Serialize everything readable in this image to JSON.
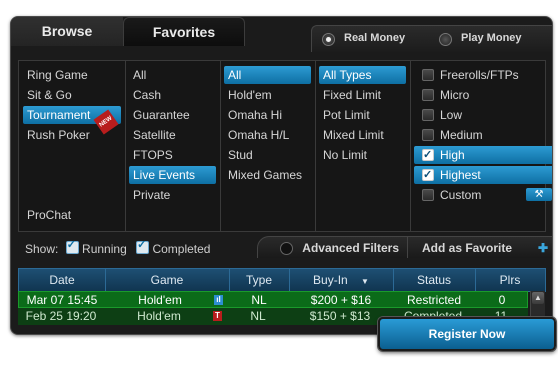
{
  "tabs": {
    "browse": "Browse",
    "favorites": "Favorites"
  },
  "money": {
    "real": "Real Money",
    "play": "Play Money",
    "selected": "real"
  },
  "col1": {
    "items": [
      "Ring Game",
      "Sit & Go",
      "Tournament",
      "Rush Poker"
    ],
    "selected": 2,
    "new_badge": "NEW",
    "prochat": "ProChat"
  },
  "col2": {
    "items": [
      "All",
      "Cash",
      "Guarantee",
      "Satellite",
      "FTOPS",
      "Live Events",
      "Private"
    ],
    "selected": 5
  },
  "col3": {
    "items": [
      "All",
      "Hold'em",
      "Omaha Hi",
      "Omaha H/L",
      "Stud",
      "Mixed Games"
    ],
    "selected": 0
  },
  "col4": {
    "items": [
      "All Types",
      "Fixed Limit",
      "Pot Limit",
      "Mixed Limit",
      "No Limit"
    ],
    "selected": 0
  },
  "col5": {
    "items": [
      {
        "label": "Freerolls/FTPs",
        "checked": false
      },
      {
        "label": "Micro",
        "checked": false
      },
      {
        "label": "Low",
        "checked": false
      },
      {
        "label": "Medium",
        "checked": false
      },
      {
        "label": "High",
        "checked": true
      },
      {
        "label": "Highest",
        "checked": true
      },
      {
        "label": "Custom",
        "checked": false
      }
    ]
  },
  "show": {
    "label": "Show:",
    "running": "Running",
    "completed": "Completed"
  },
  "advanced_filters": "Advanced Filters",
  "add_favorite": "Add as Favorite",
  "table": {
    "headers": [
      "Date",
      "Game",
      "Type",
      "Buy-In",
      "Status",
      "Plrs"
    ],
    "rows": [
      {
        "date": "Mar 07 15:45",
        "game": "Hold'em",
        "icon": "ıl",
        "type": "NL",
        "buyin": "$200 + $16",
        "status": "Restricted",
        "plrs": "0"
      },
      {
        "date": "Feb 25 19:20",
        "game": "Hold'em",
        "icon": "T",
        "type": "NL",
        "buyin": "$150 + $13",
        "status": "Completed",
        "plrs": "11"
      }
    ]
  },
  "register": "Register Now",
  "colors": {
    "accent": "#1a88c4",
    "row_selected": "#0b6b19",
    "row_other": "#0d3f14"
  }
}
